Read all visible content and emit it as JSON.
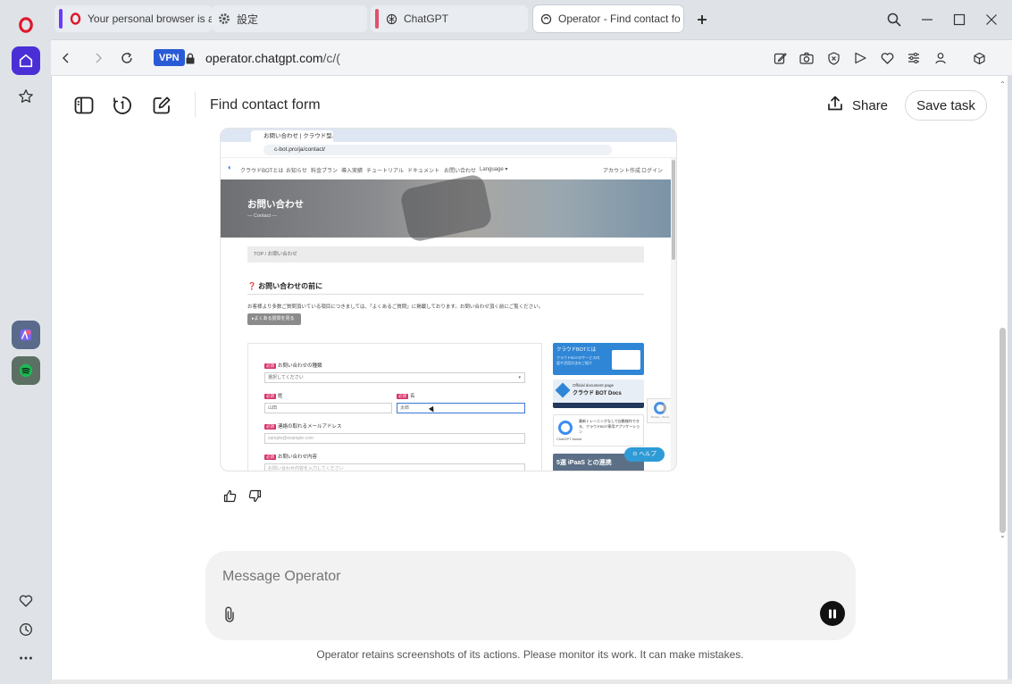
{
  "browser": {
    "tabs": [
      {
        "title": "Your personal browser is a",
        "accent": "#6b3cf5",
        "icon": "opera-icon"
      },
      {
        "title": "設定",
        "accent": "#6b3cf5",
        "icon": "gear-icon"
      },
      {
        "title": "ChatGPT",
        "accent": "#e0506a",
        "icon": "chatgpt-icon"
      },
      {
        "title": "Operator - Find contact fo",
        "accent": "",
        "icon": "operator-icon",
        "active": true
      }
    ],
    "vpn_label": "VPN",
    "url_host": "operator.chatgpt.com",
    "url_path": "/c/("
  },
  "sidebar": {
    "items": [
      "opera-logo-icon",
      "home-icon",
      "star-icon",
      "aria-app-icon",
      "spotify-icon",
      "heart-icon",
      "history-icon",
      "more-icon"
    ]
  },
  "operator": {
    "title": "Find contact form",
    "share_label": "Share",
    "save_label": "Save task",
    "composer_placeholder": "Message Operator",
    "footnote": "Operator retains screenshots of its actions. Please monitor its work. It can make mistakes."
  },
  "screenshot": {
    "tab_title": "お問い合わせ | クラウド型...",
    "url": "c-bot.pro/ja/contact/",
    "nav_items": [
      "クラウドBOTとは",
      "お知らせ",
      "料金プラン",
      "導入実績",
      "チュートリアル",
      "ドキュメント",
      "お問い合わせ",
      "Language ▾"
    ],
    "nav_right": [
      "アカウント作成",
      "ログイン"
    ],
    "hero_title": "お問い合わせ",
    "hero_subtitle": "— Contact —",
    "breadcrumb": "TOP / お問い合わせ",
    "section_heading": "❓ お問い合わせの前に",
    "section_text": "お客様より多数ご質問頂いている項目につきましては、「よくあるご質問」に掲載しております。お問い合わせ頂く前にご覧ください。",
    "faq_button": "▸よくある質問を見る",
    "form": {
      "required_tag": "必須",
      "inquiry_type_label": "お問い合わせの種類",
      "inquiry_type_value": "選択してください",
      "last_name_label": "姓",
      "last_name_value": "山田",
      "first_name_label": "名",
      "first_name_value": "太郎",
      "email_label": "連絡の取れるメールアドレス",
      "email_placeholder": "sample@example.com",
      "message_label": "お問い合わせ内容",
      "message_placeholder": "お問い合わせ内容を入力してください"
    },
    "banners": [
      {
        "text": "クラウドBOTとは",
        "sub": "クラウドBOTのサービス内容や活用方法をご紹介"
      },
      {
        "text": "クラウド BOT Docs",
        "sub": "Official document page"
      },
      {
        "text": "ChatGPT Assist",
        "sub": "最新トレーニングなしで自動操作できる、クラウドBOT専用アプリケーション"
      },
      {
        "text": "5選 iPaaS との連携"
      }
    ],
    "help_label": "ヘルプ",
    "captcha_text": "Privacy - Terms"
  }
}
